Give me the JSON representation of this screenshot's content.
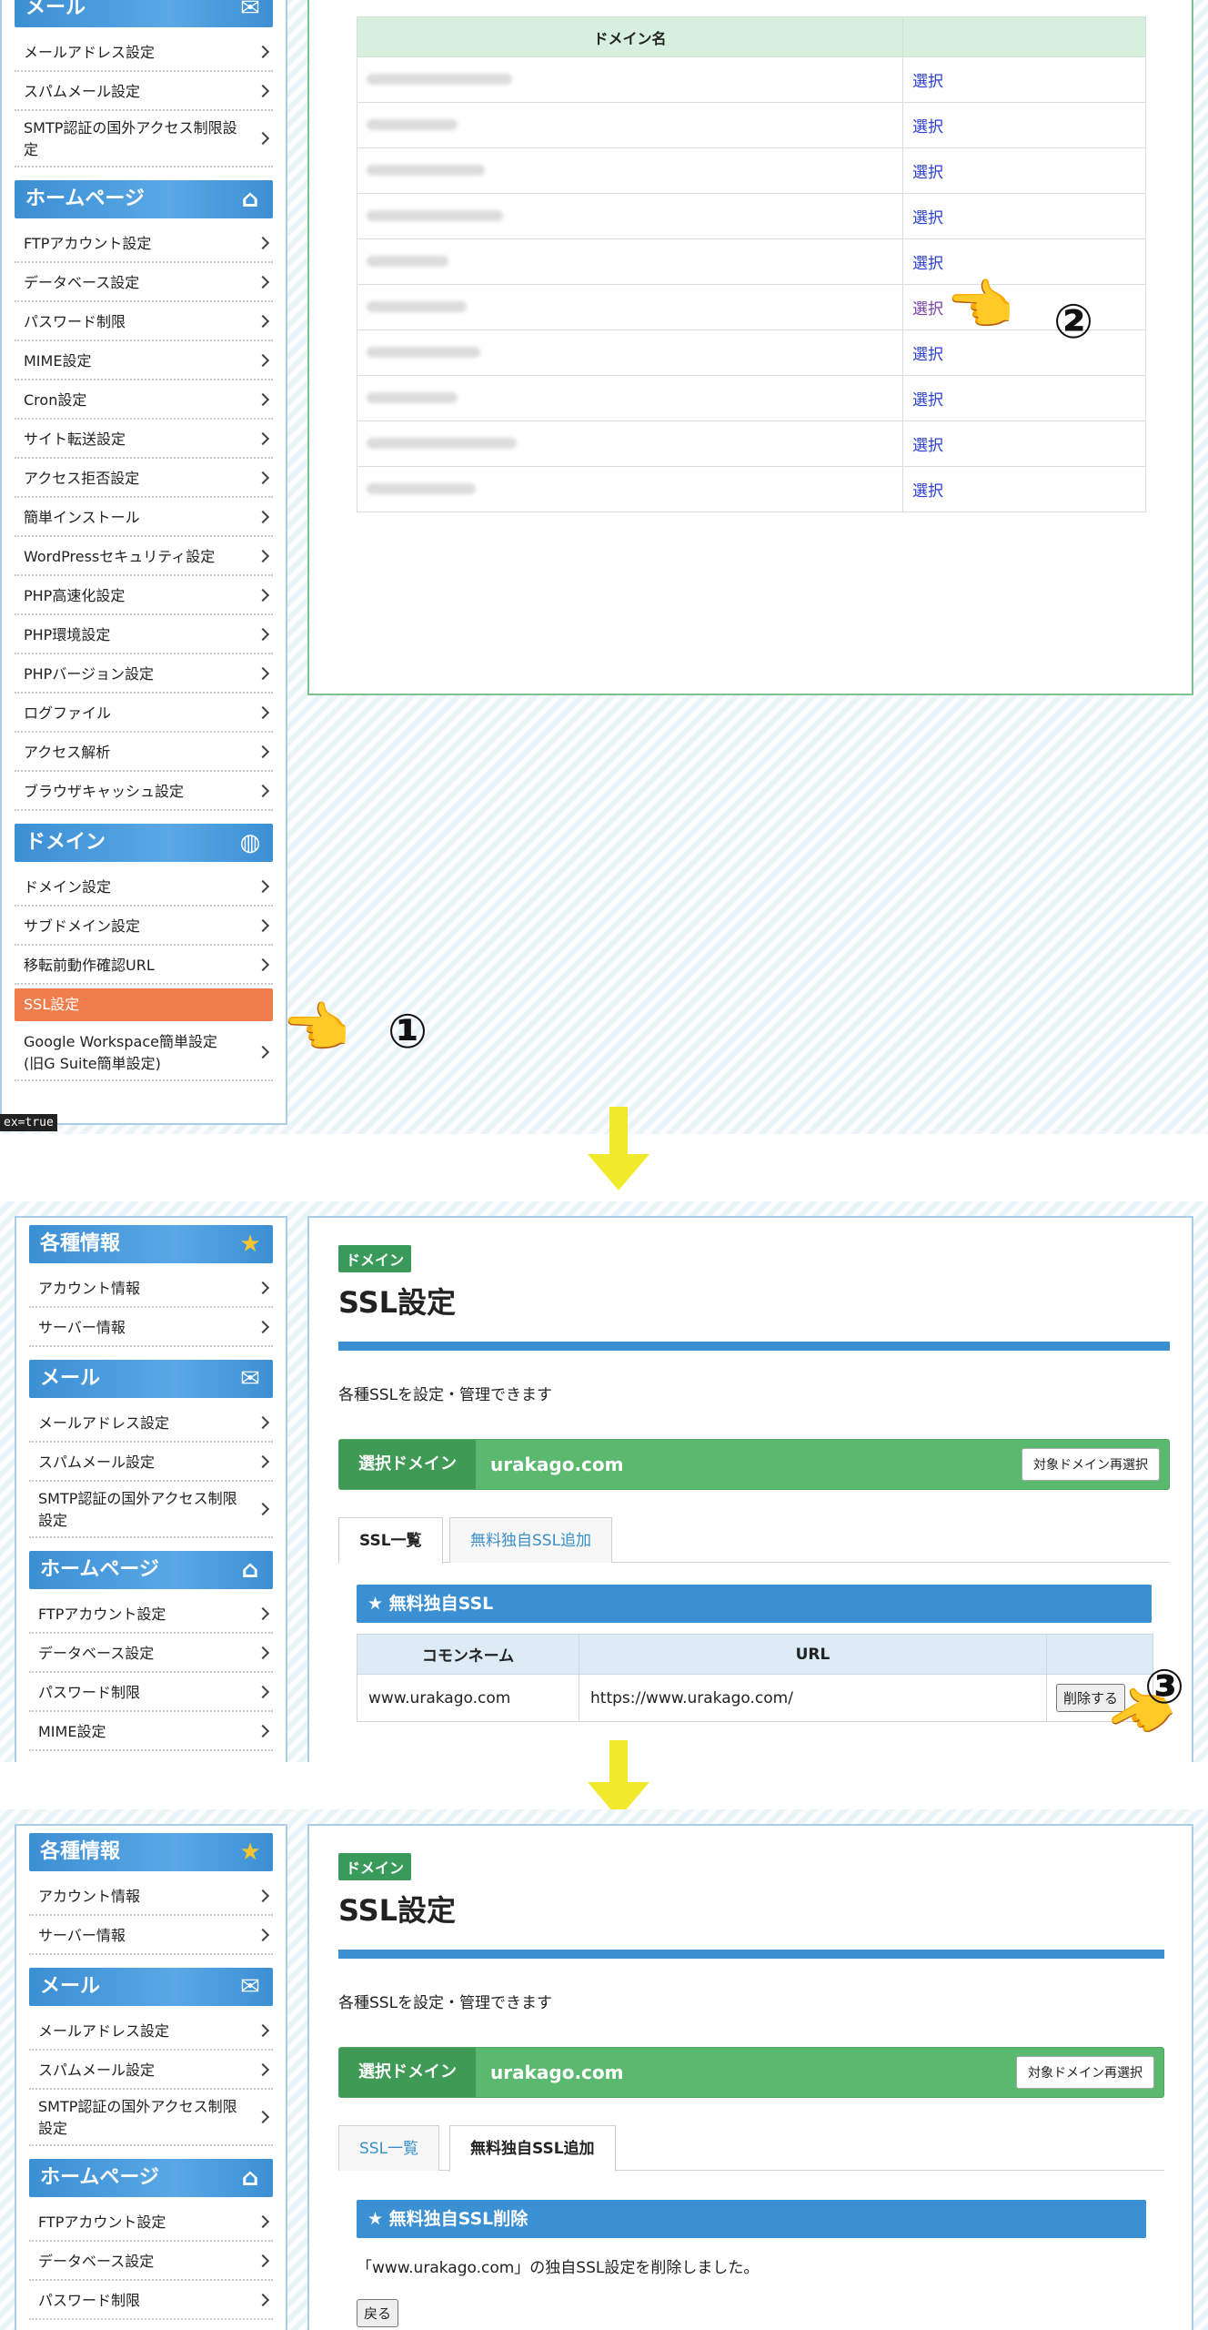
{
  "step1": {
    "sidebar": {
      "mail_header": "メール",
      "mail_items": [
        "メールアドレス設定",
        "スパムメール設定",
        "SMTP認証の国外アクセス制限設定"
      ],
      "homepage_header": "ホームページ",
      "homepage_items": [
        "FTPアカウント設定",
        "データベース設定",
        "パスワード制限",
        "MIME設定",
        "Cron設定",
        "サイト転送設定",
        "アクセス拒否設定",
        "簡単インストール",
        "WordPressセキュリティ設定",
        "PHP高速化設定",
        "PHP環境設定",
        "PHPバージョン設定",
        "ログファイル",
        "アクセス解析",
        "ブラウザキャッシュ設定"
      ],
      "domain_header": "ドメイン",
      "domain_items": [
        "ドメイン設定",
        "サブドメイン設定",
        "移転前動作確認URL",
        "SSL設定",
        "Google Workspace簡単設定 (旧G Suite簡単設定)"
      ]
    },
    "domain_table": {
      "header": "ドメイン名",
      "select_label": "選択",
      "row_count": 10
    },
    "marker1": "①",
    "marker2": "②",
    "tooltip": "ex=true"
  },
  "step2": {
    "sidebar": {
      "info_header": "各種情報",
      "info_items": [
        "アカウント情報",
        "サーバー情報"
      ],
      "mail_header": "メール",
      "mail_items": [
        "メールアドレス設定",
        "スパムメール設定",
        "SMTP認証の国外アクセス制限設定"
      ],
      "homepage_header": "ホームページ",
      "homepage_items": [
        "FTPアカウント設定",
        "データベース設定",
        "パスワード制限",
        "MIME設定"
      ]
    },
    "tag": "ドメイン",
    "title": "SSL設定",
    "description": "各種SSLを設定・管理できます",
    "domain_bar": {
      "label": "選択ドメイン",
      "value": "urakago.com",
      "button": "対象ドメイン再選択"
    },
    "tabs": [
      "SSL一覧",
      "無料独自SSL追加"
    ],
    "section_header": "★ 無料独自SSL",
    "table": {
      "headers": [
        "コモンネーム",
        "URL",
        ""
      ],
      "row": {
        "common_name": "www.urakago.com",
        "url": "https://www.urakago.com/",
        "button": "削除する"
      }
    },
    "marker3": "③"
  },
  "step3": {
    "sidebar": {
      "info_header": "各種情報",
      "info_items": [
        "アカウント情報",
        "サーバー情報"
      ],
      "mail_header": "メール",
      "mail_items": [
        "メールアドレス設定",
        "スパムメール設定",
        "SMTP認証の国外アクセス制限設定"
      ],
      "homepage_header": "ホームページ",
      "homepage_items": [
        "FTPアカウント設定",
        "データベース設定",
        "パスワード制限"
      ]
    },
    "tag": "ドメイン",
    "title": "SSL設定",
    "description": "各種SSLを設定・管理できます",
    "domain_bar": {
      "label": "選択ドメイン",
      "value": "urakago.com",
      "button": "対象ドメイン再選択"
    },
    "tabs": [
      "SSL一覧",
      "無料独自SSL追加"
    ],
    "section_header": "★ 無料独自SSL削除",
    "message": "「www.urakago.com」の独自SSL設定を削除しました。",
    "back_button": "戻る"
  },
  "colors": {
    "accent_blue": "#3b8fd3",
    "accent_green": "#5bb86f",
    "active_orange": "#f07e4c",
    "arrow_yellow": "#f1ea2c"
  }
}
